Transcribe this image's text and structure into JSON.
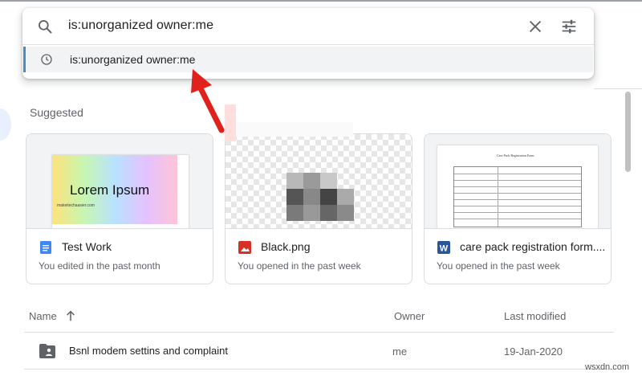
{
  "search": {
    "query": "is:unorganized owner:me",
    "suggestion": "is:unorganized owner:me",
    "icons": {
      "search": "search-icon",
      "clear": "close-icon",
      "options": "tune-icon",
      "history": "history-icon"
    }
  },
  "suggested": {
    "heading": "Suggested",
    "cards": [
      {
        "title": "Test Work",
        "subtitle": "You edited in the past month",
        "icon": "docs-icon",
        "icon_color": "#4285f4",
        "preview_text": "Lorem Ipsum",
        "preview_small": "makeitechaasier.com"
      },
      {
        "title": "Black.png",
        "subtitle": "You opened in the past week",
        "icon": "image-icon",
        "icon_color": "#d93025"
      },
      {
        "title": "care pack registration form....",
        "subtitle": "You opened in the past week",
        "icon": "word-icon",
        "icon_color": "#2b579a",
        "icon_letter": "W",
        "preview_title": "Care Pack Registration Form"
      }
    ]
  },
  "file_list": {
    "columns": {
      "name": "Name",
      "owner": "Owner",
      "modified": "Last modified"
    },
    "sort": "arrow-up-icon",
    "rows": [
      {
        "name": "Bsnl modem settins and complaint",
        "owner": "me",
        "modified": "19-Jan-2020",
        "icon": "shared-folder-icon"
      }
    ]
  },
  "annotation": {
    "color": "#e0221c"
  },
  "watermark": "wsxdn.com"
}
